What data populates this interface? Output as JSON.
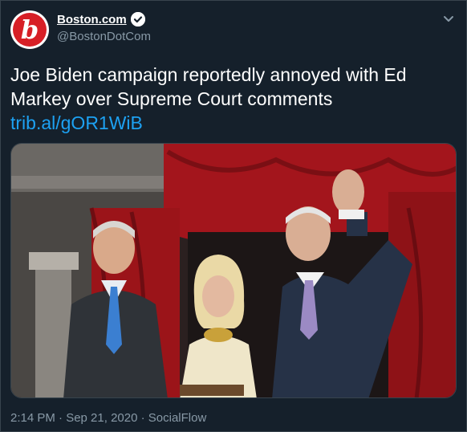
{
  "account": {
    "display_name": "Boston.com",
    "handle": "@BostonDotCom",
    "avatar_letter": "b",
    "brand_color": "#d71f26"
  },
  "tweet": {
    "headline": "Joe Biden campaign reportedly annoyed with Ed Markey over Supreme Court comments",
    "link": "trib.al/gOR1WiB",
    "timestamp": "2:14 PM · Sep 21, 2020",
    "separator": " · ",
    "source": "SocialFlow"
  },
  "icons": {
    "verified": "verified-badge-icon",
    "caret": "chevron-down-icon"
  },
  "colors": {
    "background": "#15202b",
    "text": "#ffffff",
    "secondary": "#8899a6",
    "link": "#1da1f2",
    "curtain": "#a3151c"
  }
}
